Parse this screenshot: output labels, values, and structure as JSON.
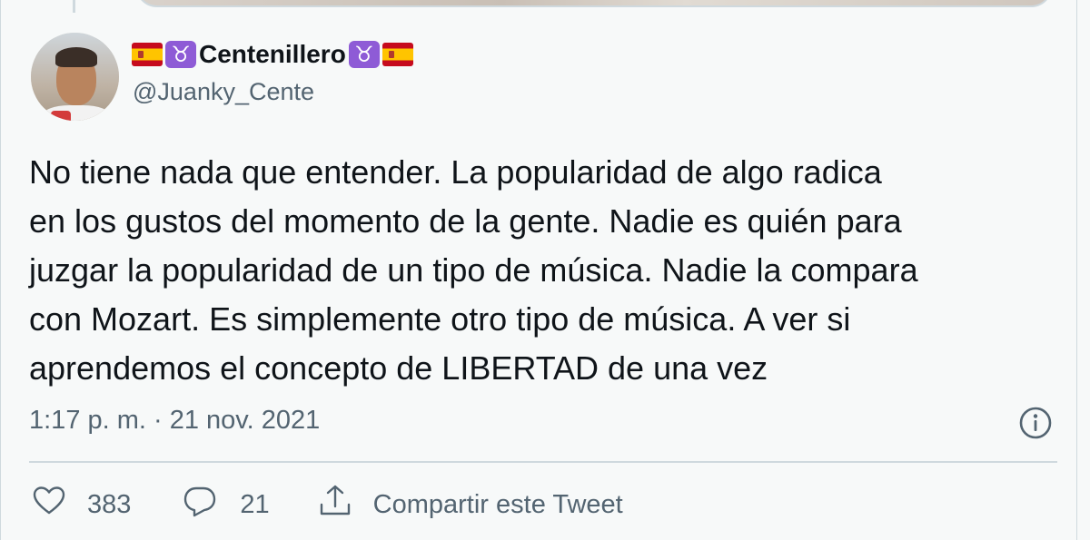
{
  "tweet": {
    "author": {
      "display_name": "Centenillero",
      "handle": "@Juanky_Cente",
      "name_emojis": [
        "spain-flag",
        "taurus-sign",
        "taurus-sign",
        "spain-flag"
      ]
    },
    "text_lines": [
      "No tiene nada que entender. La popularidad de algo radica",
      "en los gustos del momento de la gente. Nadie es quién para",
      "juzgar la popularidad de un tipo de música. Nadie la compara",
      "con Mozart. Es simplemente otro tipo de música. A ver si",
      "aprendemos el concepto de LIBERTAD de una vez"
    ],
    "timestamp": "1:17 p. m. · 21 nov. 2021",
    "actions": {
      "like_count": "383",
      "reply_count": "21",
      "share_label": "Compartir este Tweet"
    }
  },
  "colors": {
    "text_primary": "#0f1419",
    "text_secondary": "#536471",
    "background": "#f7f9f9",
    "divider": "#cfd9de",
    "taurus_purple": "#8e5bd6"
  },
  "icons": [
    "info-icon",
    "heart-icon",
    "reply-icon",
    "share-icon"
  ]
}
